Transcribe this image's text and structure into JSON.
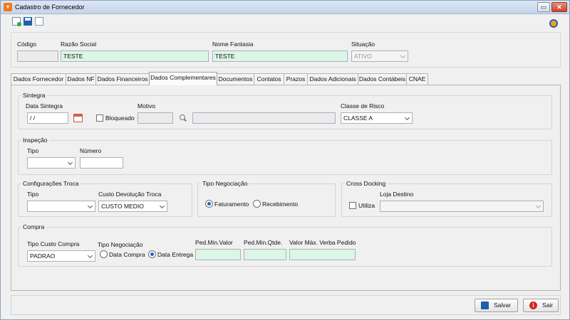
{
  "window": {
    "title": "Cadastro de Fornecedor",
    "restore_symbol": "▭",
    "close_symbol": "✕",
    "app_icon_symbol": "▾"
  },
  "toolbar": {
    "icons": [
      "new-document-icon",
      "save-icon",
      "blank-document-icon"
    ],
    "help_icon": "help-icon"
  },
  "header": {
    "codigo": {
      "label": "Código",
      "value": ""
    },
    "razao_social": {
      "label": "Razão Social",
      "value": "TESTE"
    },
    "nome_fantasia": {
      "label": "Nome Fantasia",
      "value": "TESTE"
    },
    "situacao": {
      "label": "Situação",
      "value": "ATIVO"
    }
  },
  "tabs": [
    "Dados Fornecedor",
    "Dados NF",
    "Dados Financeiros",
    "Dados Complementares",
    "Documentos",
    "Contatos",
    "Prazos",
    "Dados Adicionais",
    "Dados Contábeis",
    "CNAE"
  ],
  "active_tab": "Dados Complementares",
  "sintegra": {
    "title": "Sintegra",
    "data_label": "Data Sintegra",
    "data_value": " / /",
    "bloqueado_label": "Bloqueado",
    "bloqueado_checked": false,
    "motivo_label": "Motivo",
    "motivo_code": "",
    "motivo_desc": "",
    "classe_label": "Classe de Risco",
    "classe_value": "CLASSE A"
  },
  "inspecao": {
    "title": "Inspeção",
    "tipo_label": "Tipo",
    "tipo_value": "",
    "numero_label": "Número",
    "numero_value": ""
  },
  "config_troca": {
    "title": "Configurações Troca",
    "tipo_label": "Tipo",
    "tipo_value": "",
    "custo_label": "Custo Devolução Troca",
    "custo_value": "CUSTO MEDIO"
  },
  "tipo_negociacao": {
    "title": "Tipo Negociação",
    "options": [
      "Faturamento",
      "Recebimento"
    ],
    "selected": "Faturamento"
  },
  "cross_docking": {
    "title": "Cross Docking",
    "utiliza_label": "Utiliza",
    "utiliza_checked": false,
    "loja_label": "Loja Destino",
    "loja_value": ""
  },
  "compra": {
    "title": "Compra",
    "tipo_custo_label": "Tipo Custo Compra",
    "tipo_custo_value": "PADRAO",
    "tipo_neg_label": "Tipo Negociação",
    "tipo_neg_options": [
      "Data Compra",
      "Data Entrega"
    ],
    "tipo_neg_selected": "Data Entrega",
    "ped_min_valor_label": "Ped.Min.Valor",
    "ped_min_valor": "",
    "ped_min_qtde_label": "Ped.Min.Qtde.",
    "ped_min_qtde": "",
    "valor_max_label": "Valor Máx. Verba Pedido",
    "valor_max": ""
  },
  "footer": {
    "save_label": "Salvar",
    "exit_label": "Sair",
    "exit_symbol": "i"
  },
  "colors": {
    "required_field": "#dcf6e6",
    "radio_selected": "#1a64c8",
    "title_orange": "#f07a1a"
  }
}
